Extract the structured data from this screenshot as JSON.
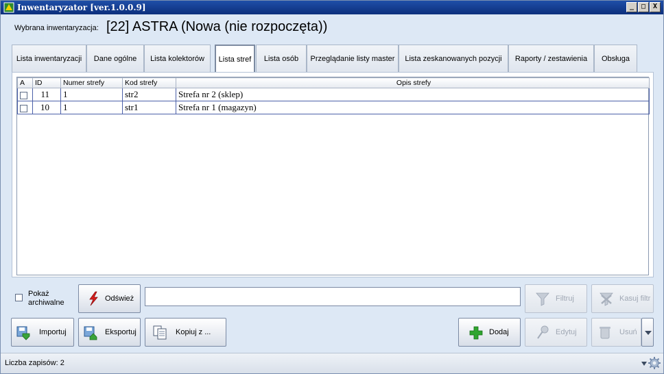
{
  "window": {
    "title": "Inwentaryzator [ver.1.0.0.9]",
    "controls": {
      "minimize": "_",
      "maximize": "□",
      "close": "X"
    }
  },
  "header": {
    "selected_label": "Wybrana inwentaryzacja:",
    "selected_value": "[22] ASTRA (Nowa (nie rozpoczęta))"
  },
  "tabs": [
    {
      "label": "Lista inwentaryzacji"
    },
    {
      "label": "Dane ogólne"
    },
    {
      "label": "Lista kolektorów"
    },
    {
      "label": "Lista stref",
      "active": true
    },
    {
      "label": "Lista osób"
    },
    {
      "label": "Przeglądanie listy master"
    },
    {
      "label": "Lista zeskanowanych pozycji"
    },
    {
      "label": "Raporty / zestawienia"
    },
    {
      "label": "Obsługa"
    }
  ],
  "table": {
    "columns": [
      "A",
      "ID",
      "Numer strefy",
      "Kod strefy",
      "Opis strefy"
    ],
    "rows": [
      {
        "checked": false,
        "id": "11",
        "numer": "1",
        "kod": "str2",
        "opis": "Strefa nr 2 (sklep)"
      },
      {
        "checked": false,
        "id": "10",
        "numer": "1",
        "kod": "str1",
        "opis": "Strefa nr 1 (magazyn)"
      }
    ]
  },
  "controls": {
    "show_archived_label": "Pokaż archiwalne",
    "refresh_label": "Odśwież",
    "search_value": "",
    "filter_label": "Filtruj",
    "clear_filter_label": "Kasuj filtr",
    "import_label": "Importuj",
    "export_label": "Eksportuj",
    "copy_label": "Kopiuj z ...",
    "add_label": "Dodaj",
    "edit_label": "Edytuj",
    "delete_label": "Usuń"
  },
  "status": {
    "text": "Liczba zapisów: 2"
  },
  "colors": {
    "titlebar": "#0c2f7c",
    "accent": "#4b5fa8",
    "add_green": "#2fa52f",
    "refresh_red": "#d81e1e"
  }
}
